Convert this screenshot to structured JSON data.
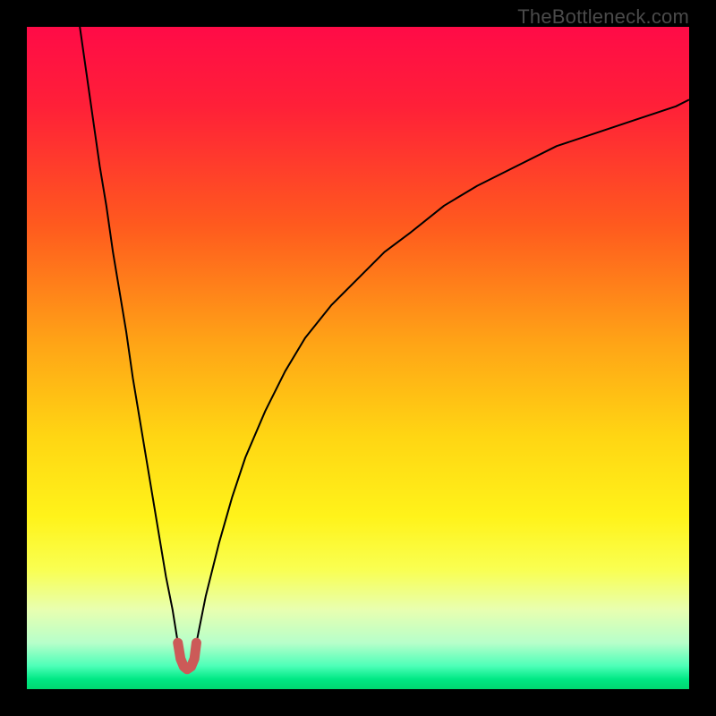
{
  "watermark": "TheBottleneck.com",
  "chart_data": {
    "type": "line",
    "title": "",
    "xlabel": "",
    "ylabel": "",
    "xlim": [
      0,
      100
    ],
    "ylim": [
      0,
      100
    ],
    "gradient_stops": [
      {
        "offset": 0.0,
        "color": "#ff0b47"
      },
      {
        "offset": 0.12,
        "color": "#ff2038"
      },
      {
        "offset": 0.3,
        "color": "#ff5a1e"
      },
      {
        "offset": 0.48,
        "color": "#ffa516"
      },
      {
        "offset": 0.62,
        "color": "#ffd613"
      },
      {
        "offset": 0.74,
        "color": "#fff31a"
      },
      {
        "offset": 0.82,
        "color": "#f9ff52"
      },
      {
        "offset": 0.88,
        "color": "#e8ffb0"
      },
      {
        "offset": 0.93,
        "color": "#b7ffca"
      },
      {
        "offset": 0.965,
        "color": "#4dffb8"
      },
      {
        "offset": 0.985,
        "color": "#00e884"
      },
      {
        "offset": 1.0,
        "color": "#00d86f"
      }
    ],
    "series": [
      {
        "name": "left-branch",
        "stroke": "#000000",
        "stroke_width": 2,
        "x": [
          8,
          9,
          10,
          11,
          12,
          13,
          14,
          15,
          16,
          17,
          18,
          19,
          20,
          21,
          22,
          22.8
        ],
        "y": [
          100,
          93,
          86,
          79,
          73,
          66,
          60,
          54,
          47,
          41,
          35,
          29,
          23,
          17,
          12,
          7
        ]
      },
      {
        "name": "right-branch",
        "stroke": "#000000",
        "stroke_width": 2,
        "x": [
          25.6,
          27,
          29,
          31,
          33,
          36,
          39,
          42,
          46,
          50,
          54,
          58,
          63,
          68,
          74,
          80,
          86,
          92,
          98,
          100
        ],
        "y": [
          7,
          14,
          22,
          29,
          35,
          42,
          48,
          53,
          58,
          62,
          66,
          69,
          73,
          76,
          79,
          82,
          84,
          86,
          88,
          89
        ]
      },
      {
        "name": "min-marker",
        "stroke": "#cc5a58",
        "stroke_width": 11,
        "linecap": "round",
        "x": [
          22.8,
          23.2,
          23.7,
          24.2,
          24.8,
          25.3,
          25.6
        ],
        "y": [
          7.0,
          4.6,
          3.4,
          3.0,
          3.4,
          4.6,
          7.0
        ]
      }
    ]
  }
}
